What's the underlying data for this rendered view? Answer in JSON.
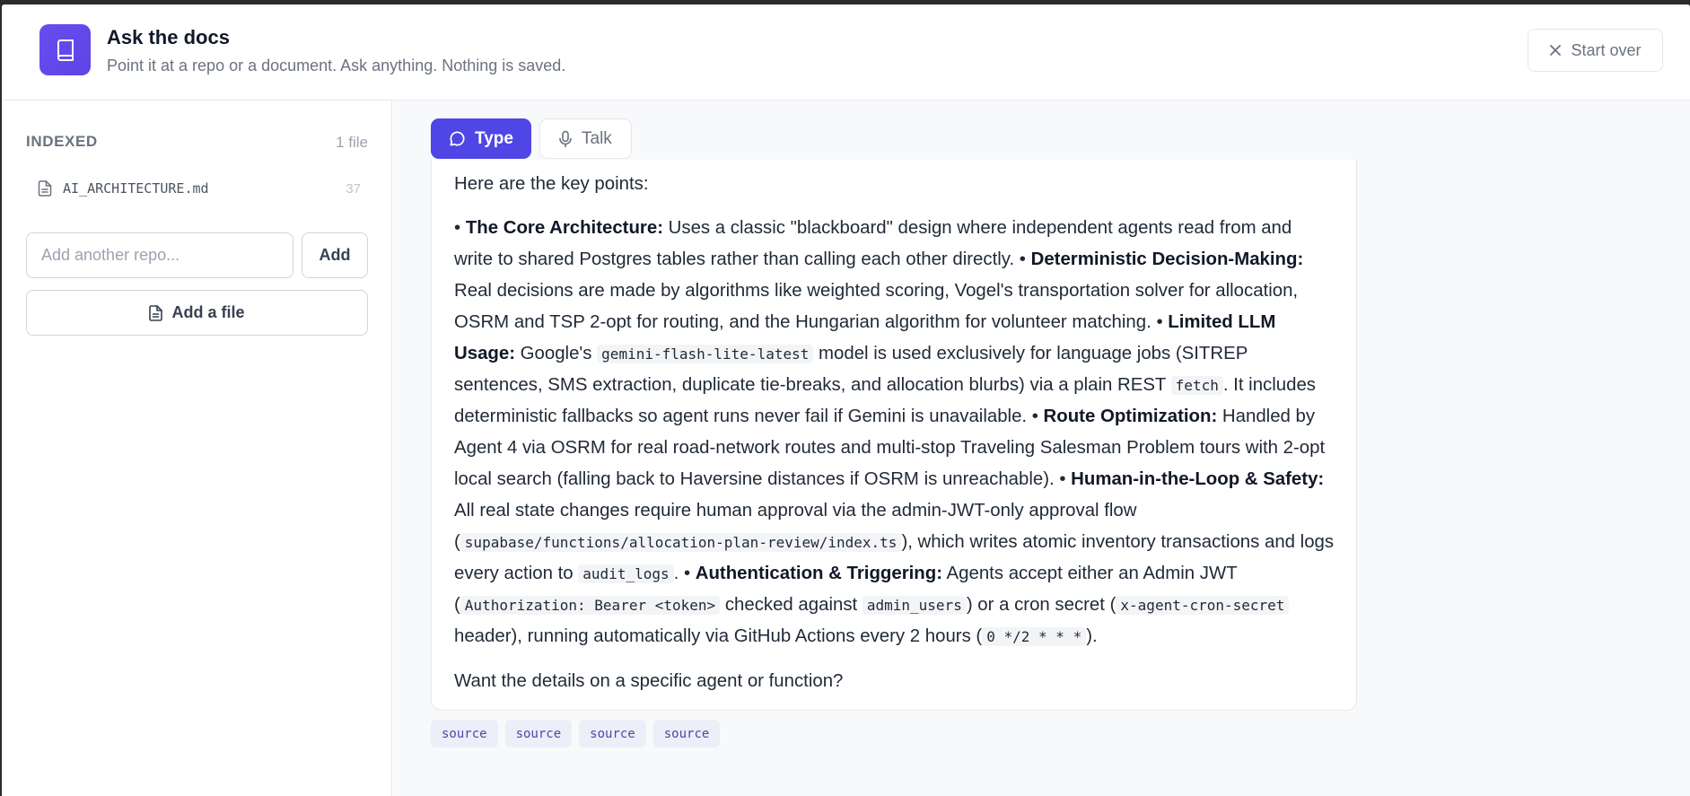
{
  "header": {
    "title": "Ask the docs",
    "subtitle": "Point it at a repo or a document. Ask anything. Nothing is saved.",
    "logo_icon": "book-icon",
    "start_over_label": "Start over",
    "accent_color": "#5b45e6"
  },
  "sidebar": {
    "indexed_label": "INDEXED",
    "file_count": "1 file",
    "files": [
      {
        "name": "AI_ARCHITECTURE.md",
        "count": "37",
        "icon": "file-text-icon"
      }
    ],
    "repo_input_placeholder": "Add another repo...",
    "add_label": "Add",
    "add_file_label": "Add a file"
  },
  "tabs": [
    {
      "label": "Type",
      "icon": "chat-bubble-icon",
      "active": true
    },
    {
      "label": "Talk",
      "icon": "microphone-icon",
      "active": false
    }
  ],
  "answer": {
    "intro": "Here are the key points:",
    "b1": "• ",
    "h1": "The Core Architecture:",
    "t1": " Uses a classic \"blackboard\" design where independent agents read from and write to shared Postgres tables rather than calling each other directly. • ",
    "h2": "Deterministic Decision-Making:",
    "t2": " Real decisions are made by algorithms like weighted scoring, Vogel's transportation solver for allocation, OSRM and TSP 2-opt for routing, and the Hungarian algorithm for volunteer matching. • ",
    "h3": "Limited LLM Usage:",
    "t3a": " Google's ",
    "c3a": "gemini-flash-lite-latest",
    "t3b": " model is used exclusively for language jobs (SITREP sentences, SMS extraction, duplicate tie-breaks, and allocation blurbs) via a plain REST ",
    "c3b": "fetch",
    "t3c": ". It includes deterministic fallbacks so agent runs never fail if Gemini is unavailable. • ",
    "h4": "Route Optimization:",
    "t4": " Handled by Agent 4 via OSRM for real road-network routes and multi-stop Traveling Salesman Problem tours with 2-opt local search (falling back to Haversine distances if OSRM is unreachable). • ",
    "h5": "Human-in-the-Loop & Safety:",
    "t5a": " All real state changes require human approval via the admin-JWT-only approval flow (",
    "c5a": "supabase/functions/allocation-plan-review/index.ts",
    "t5b": "), which writes atomic inventory transactions and logs every action to ",
    "c5b": "audit_logs",
    "t5c": ". • ",
    "h6": "Authentication & Triggering:",
    "t6a": " Agents accept either an Admin JWT (",
    "c6a": "Authorization: Bearer <token>",
    "t6b": " checked against ",
    "c6b": "admin_users",
    "t6c": ") or a cron secret (",
    "c6c": "x-agent-cron-secret",
    "t6d": " header), running automatically via GitHub Actions every 2 hours (",
    "c6d": "0 */2 * * *",
    "t6e": ").",
    "outro": "Want the details on a specific agent or function?"
  },
  "sources": [
    "source",
    "source",
    "source",
    "source"
  ]
}
